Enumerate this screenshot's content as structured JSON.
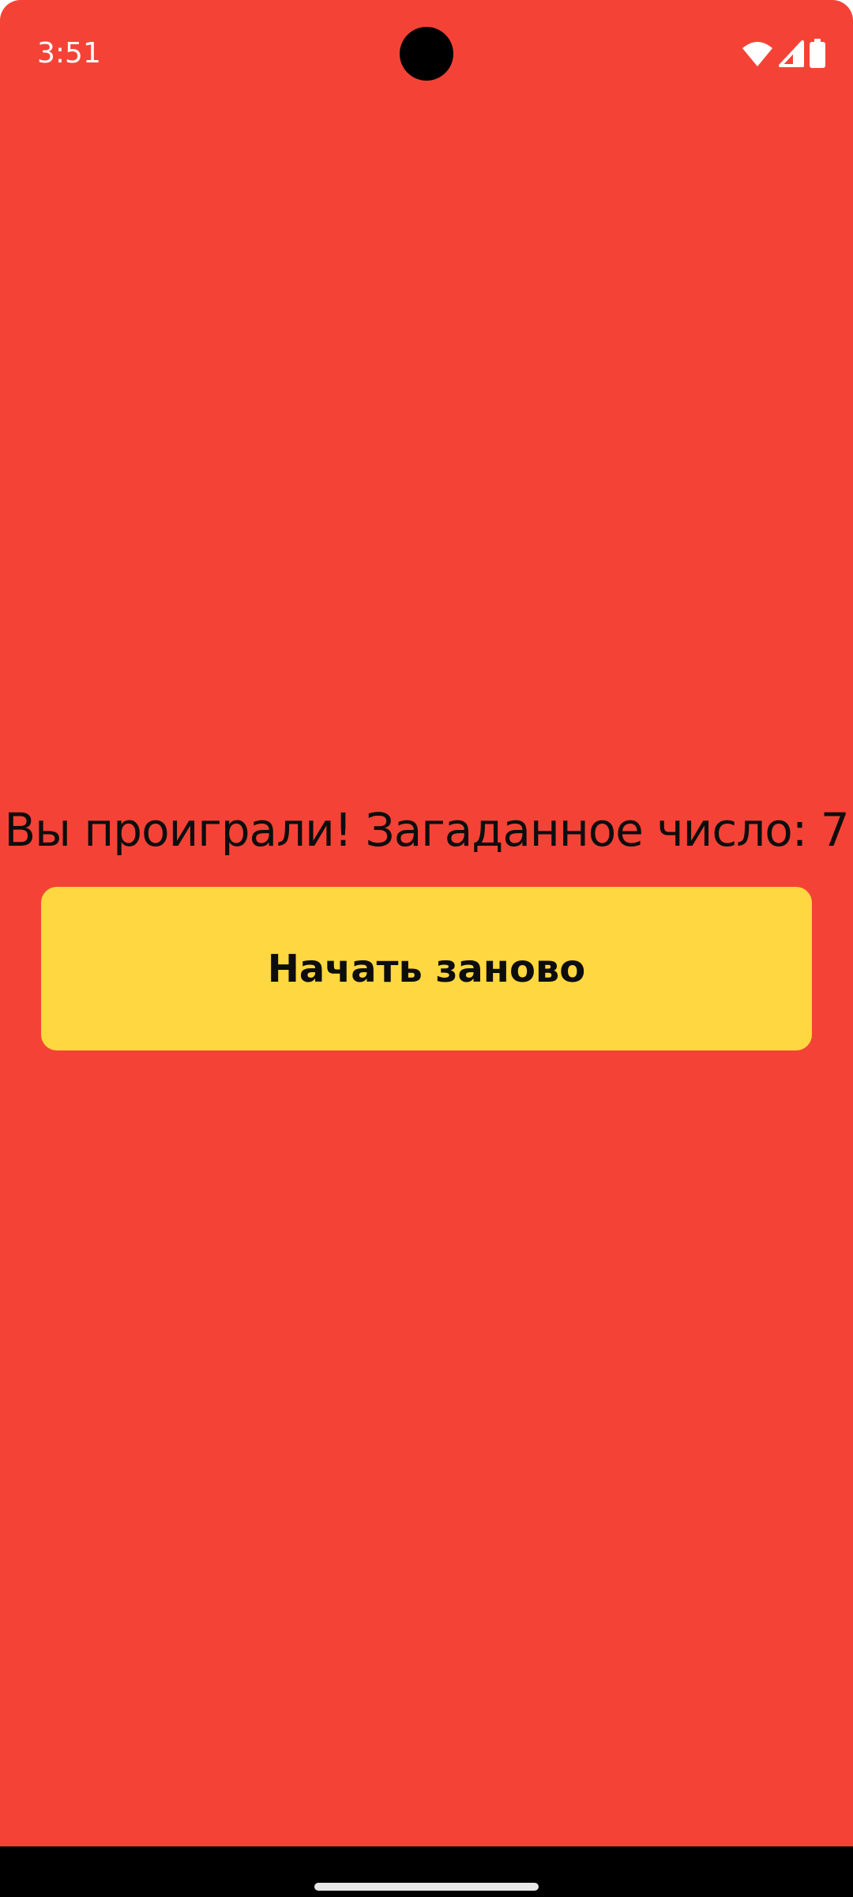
{
  "status_bar": {
    "time": "3:51",
    "icons": [
      "wifi-icon",
      "cell-signal-icon",
      "battery-icon"
    ],
    "icon_color": "#FFFFFF"
  },
  "game": {
    "message": "Вы проиграли! Загаданное число: 7",
    "restart_label": "Начать заново"
  },
  "colors": {
    "background": "#F44336",
    "button": "#FFD740",
    "text": "#0D0D0D",
    "navigation_bar": "#000000"
  }
}
